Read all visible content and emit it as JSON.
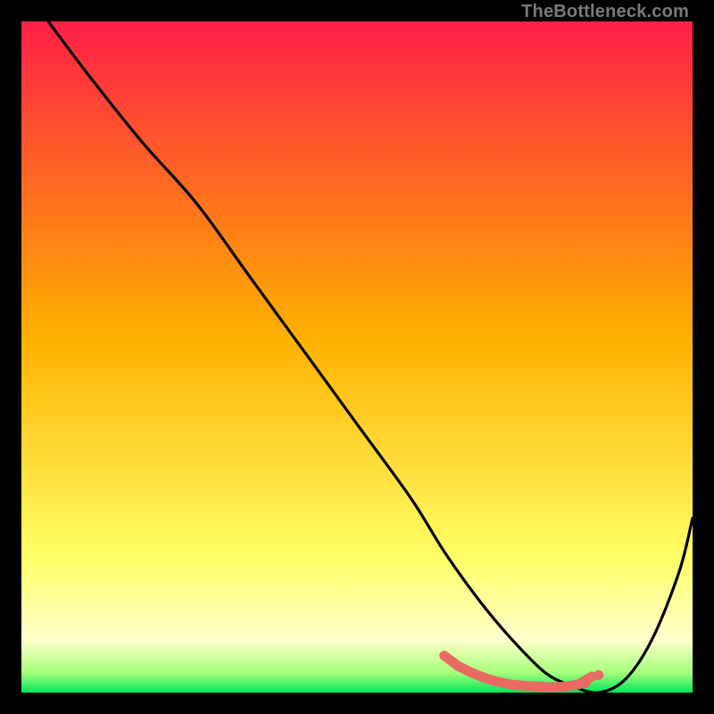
{
  "attribution": "TheBottleneck.com",
  "chart_data": {
    "type": "line",
    "title": "",
    "xlabel": "",
    "ylabel": "",
    "xlim": [
      0,
      100
    ],
    "ylim": [
      0,
      100
    ],
    "grid": false,
    "legend": false,
    "background_gradient": {
      "stops": [
        {
          "offset": 0.0,
          "color": "#ff1f47"
        },
        {
          "offset": 0.47,
          "color": "#ffb000"
        },
        {
          "offset": 0.8,
          "color": "#ffff66"
        },
        {
          "offset": 0.92,
          "color": "#ffffcc"
        },
        {
          "offset": 0.97,
          "color": "#a8ff7a"
        },
        {
          "offset": 1.0,
          "color": "#00e65c"
        }
      ]
    },
    "series": [
      {
        "name": "bottleneck-curve",
        "color": "#000000",
        "x": [
          4,
          10,
          18,
          26,
          34,
          42,
          50,
          58,
          63,
          68,
          73,
          78,
          82,
          86,
          90,
          94,
          98,
          100
        ],
        "values": [
          100,
          92,
          82,
          73,
          62,
          51,
          40,
          29,
          21,
          14,
          8,
          3,
          1,
          0,
          2,
          8,
          18,
          26
        ]
      }
    ],
    "markers": {
      "name": "highlight-region",
      "color": "#e96a63",
      "x": [
        63,
        65,
        67,
        69,
        71,
        73,
        75,
        77,
        79,
        81,
        83,
        85
      ],
      "values": [
        5.5,
        4.0,
        3.0,
        2.2,
        1.6,
        1.2,
        1.0,
        0.9,
        0.8,
        0.9,
        1.2,
        2.4
      ]
    }
  }
}
